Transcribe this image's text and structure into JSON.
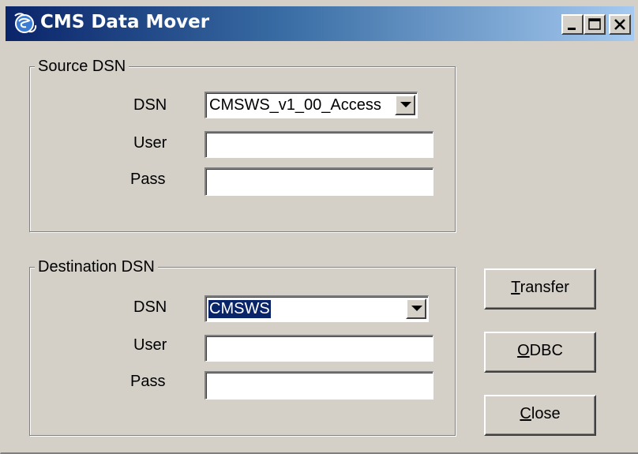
{
  "window": {
    "title": "CMS Data Mover",
    "icon": "cms-app-icon",
    "controls": [
      "minimize-icon",
      "maximize-icon",
      "close-icon"
    ]
  },
  "source": {
    "group_label": "Source DSN",
    "dsn_label": "DSN",
    "dsn_value": "CMSWS_v1_00_Access",
    "user_label": "User",
    "user_value": "",
    "pass_label": "Pass",
    "pass_value": ""
  },
  "destination": {
    "group_label": "Destination DSN",
    "dsn_label": "DSN",
    "dsn_value": "CMSWS",
    "user_label": "User",
    "user_value": "",
    "pass_label": "Pass",
    "pass_value": ""
  },
  "buttons": {
    "transfer": {
      "mnemonic": "T",
      "rest": "ransfer"
    },
    "odbc": {
      "mnemonic": "O",
      "rest": "DBC"
    },
    "close": {
      "mnemonic": "C",
      "rest": "lose"
    }
  },
  "colors": {
    "face": "#d4d0c8",
    "title_start": "#0a246a",
    "title_end": "#a6caf0",
    "selection": "#0a246a"
  }
}
